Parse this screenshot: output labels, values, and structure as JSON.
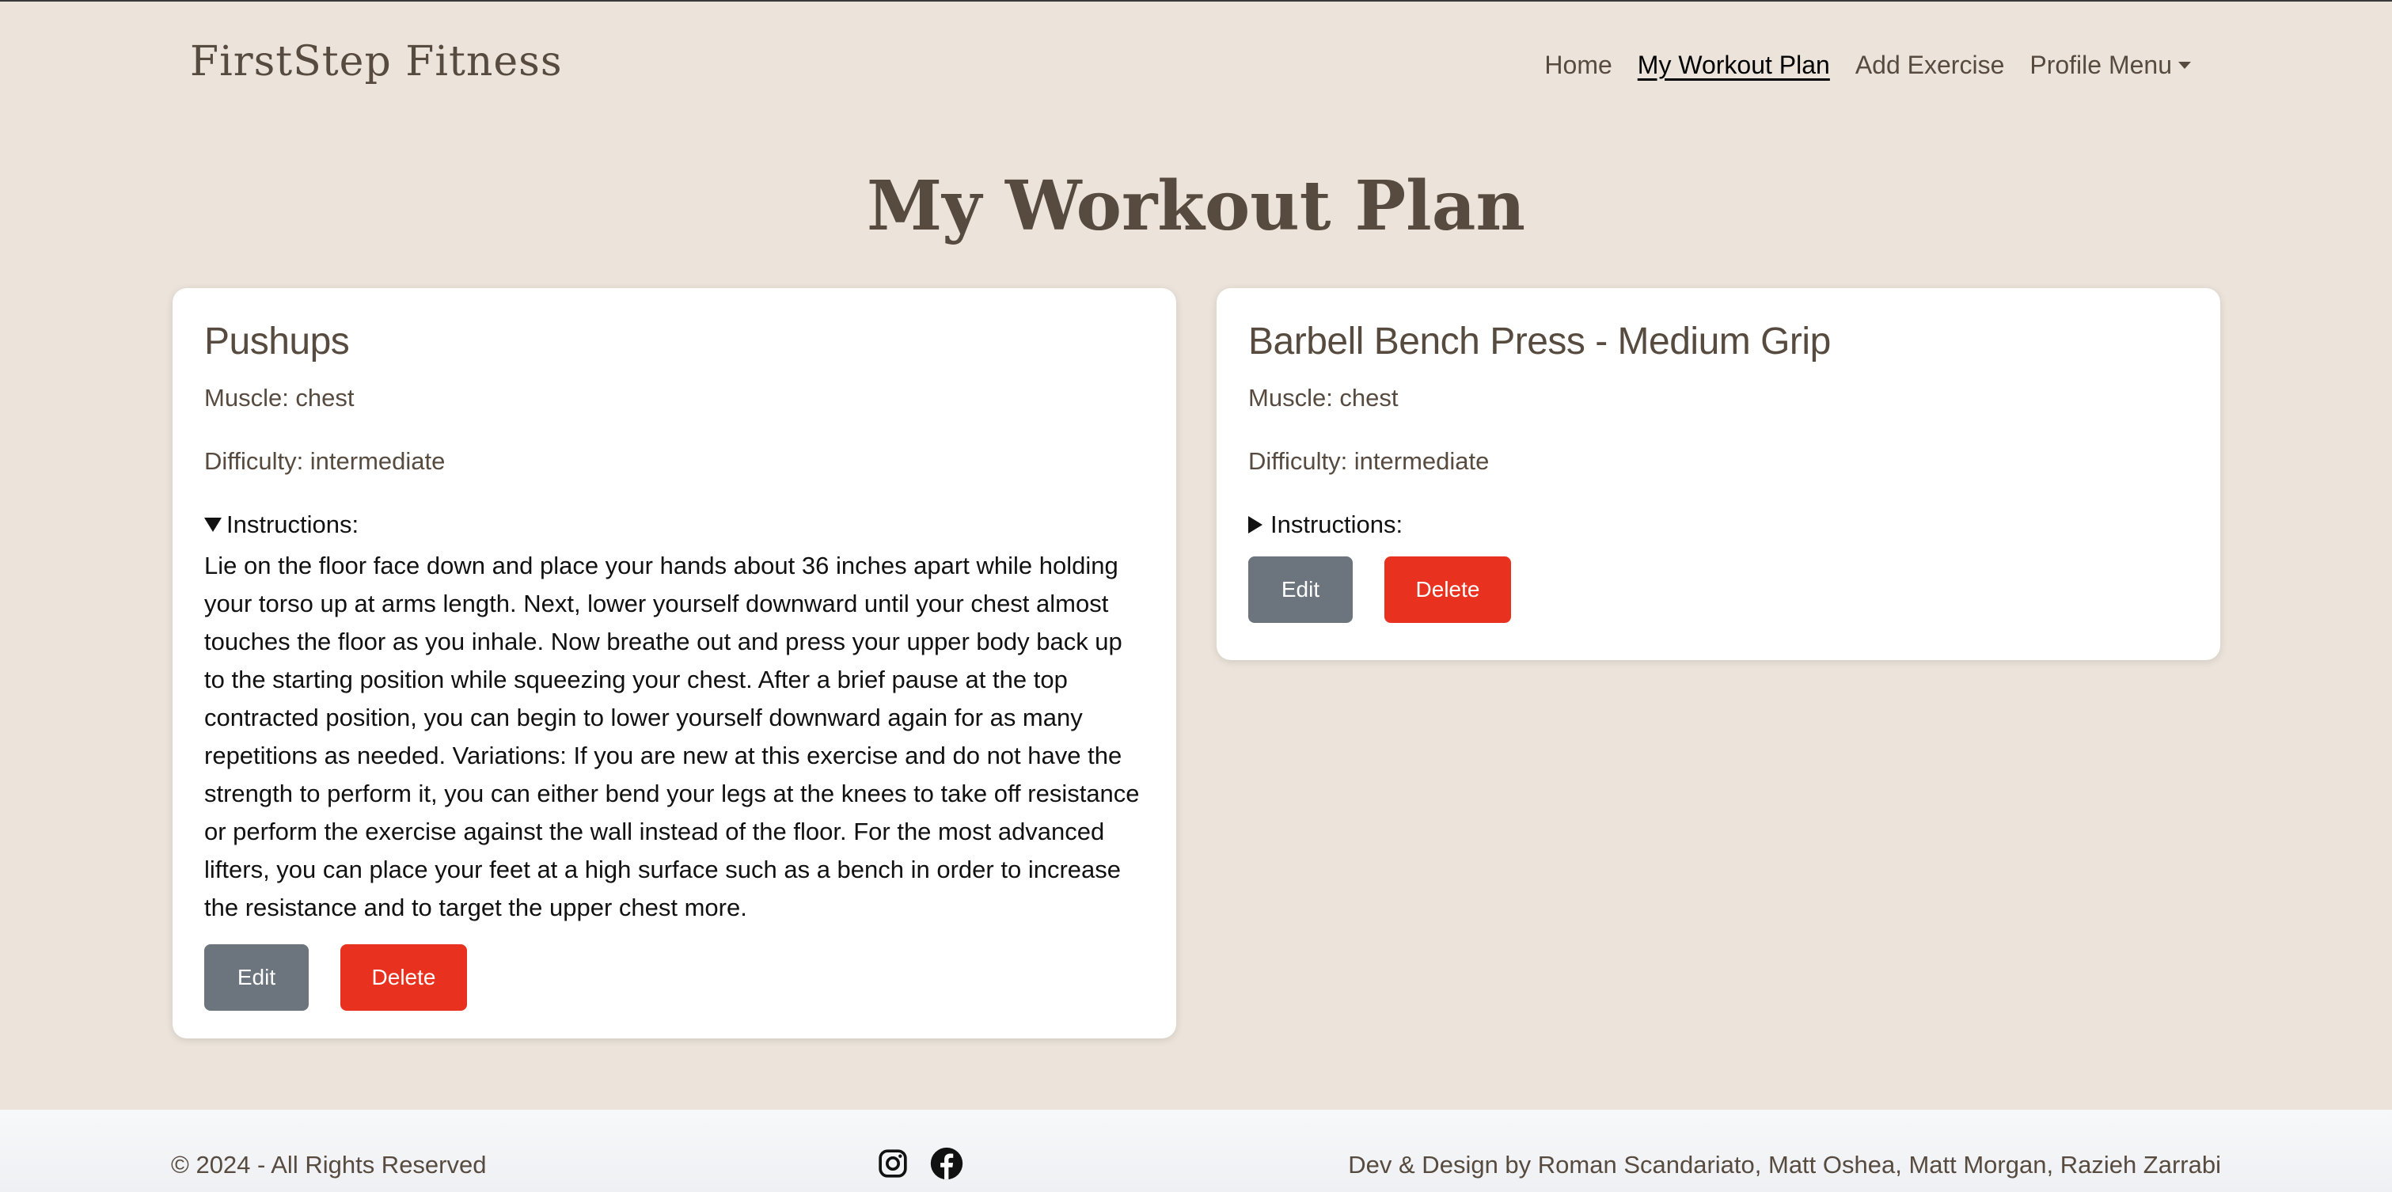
{
  "nav": {
    "brand": "FirstStep Fitness",
    "links": [
      {
        "label": "Home"
      },
      {
        "label": "My Workout Plan"
      },
      {
        "label": "Add Exercise"
      },
      {
        "label": "Profile Menu"
      }
    ]
  },
  "page": {
    "title": "My Workout Plan"
  },
  "exercises": [
    {
      "name": "Pushups",
      "muscle": "Muscle: chest",
      "difficulty": "Difficulty: intermediate",
      "instructions_label": "Instructions:",
      "instructions_expanded": true,
      "instructions": "Lie on the floor face down and place your hands about 36 inches apart while holding your torso up at arms length. Next, lower yourself downward until your chest almost touches the floor as you inhale. Now breathe out and press your upper body back up to the starting position while squeezing your chest. After a brief pause at the top contracted position, you can begin to lower yourself downward again for as many repetitions as needed. Variations: If you are new at this exercise and do not have the strength to perform it, you can either bend your legs at the knees to take off resistance or perform the exercise against the wall instead of the floor. For the most advanced lifters, you can place your feet at a high surface such as a bench in order to increase the resistance and to target the upper chest more.",
      "edit_label": "Edit",
      "delete_label": "Delete"
    },
    {
      "name": "Barbell Bench Press - Medium Grip",
      "muscle": "Muscle: chest",
      "difficulty": "Difficulty: intermediate",
      "instructions_label": "Instructions:",
      "instructions_expanded": false,
      "edit_label": "Edit",
      "delete_label": "Delete"
    }
  ],
  "footer": {
    "copyright": "© 2024 - All Rights Reserved",
    "icons": [
      "instagram-icon",
      "facebook-icon"
    ],
    "credits": "Dev & Design by Roman Scandariato, Matt Oshea, Matt Morgan, Razieh Zarrabi"
  },
  "colors": {
    "background": "#ece4da",
    "text": "#574b40",
    "edit_button": "#6c757d",
    "delete_button": "#e8311e"
  }
}
